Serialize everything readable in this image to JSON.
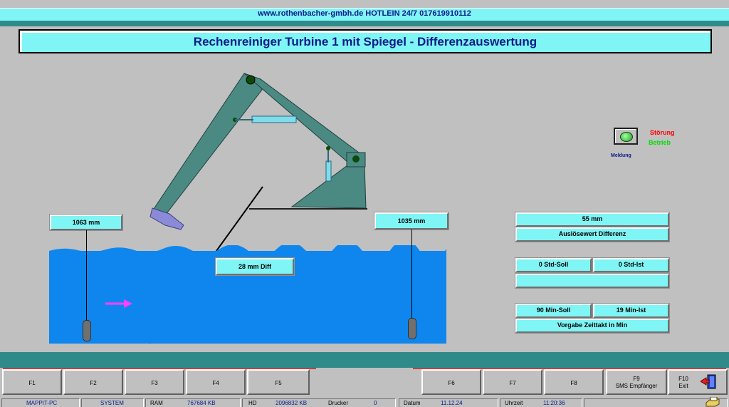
{
  "header": {
    "url_hotline": "www.rothenbacher-gmbh.de  HOTLEIN 24/7 017619910112"
  },
  "title": "Rechenreiniger  Turbine 1 mit Spiegel - Differenzauswertung",
  "levels": {
    "left": "1063 mm",
    "right": "1035 mm",
    "diff": "28 mm Diff"
  },
  "panel": {
    "trigger_value": "55 mm",
    "trigger_label": "Auslösewert Differenz",
    "std_soll": "0 Std-Soll",
    "std_ist": "0 Std-Ist",
    "std_info": "",
    "min_soll": "90 Min-Soll",
    "min_ist": "19 Min-Ist",
    "takt_label": "Vorgabe Zeittakt in Min"
  },
  "status_legend": {
    "fault": "Störung",
    "run": "Betrieb",
    "message": "Meldung"
  },
  "fkeys": {
    "f1": "F1",
    "f2": "F2",
    "f3": "F3",
    "f4": "F4",
    "f5": "F5",
    "f6": "F6",
    "f7": "F7",
    "f8": "F8",
    "f9": "F9",
    "f9_sub": "SMS Empfänger",
    "f10": "F10",
    "f10_sub": "Exit"
  },
  "statusbar": {
    "pc": "MAPPIT-PC",
    "system": "SYSTEM",
    "ram_label": "RAM",
    "ram_value": "767684 KB",
    "hd_label": "HD",
    "hd_value": "2096832 KB",
    "printer_label": "Drucker",
    "printer_value": "0",
    "date_label": "Datum",
    "date_value": "11.12.24",
    "time_label": "Uhrzeit",
    "time_value": "11:20:36"
  },
  "colors": {
    "accent": "#7ff5f5",
    "water": "#0f86ee",
    "teal": "#2f8a8a",
    "machine": "#4a8a82",
    "text_blue": "#0a1a8a"
  }
}
